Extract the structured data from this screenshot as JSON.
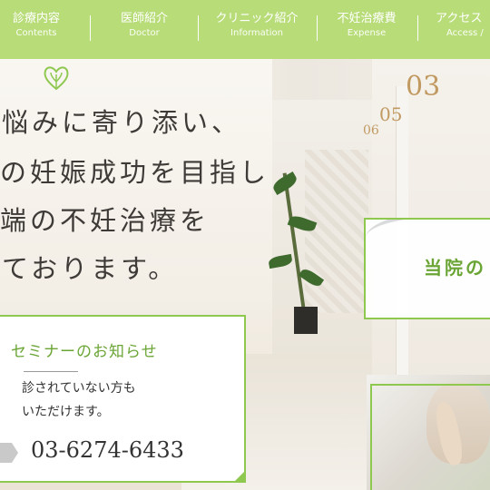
{
  "nav": {
    "items": [
      {
        "jp": "診療内容",
        "en": "Contents"
      },
      {
        "jp": "医師紹介",
        "en": "Doctor"
      },
      {
        "jp": "クリニック紹介",
        "en": "Information"
      },
      {
        "jp": "不妊治療費",
        "en": "Expense"
      },
      {
        "jp": "アクセス",
        "en": "Access /"
      }
    ],
    "background": "#b8dc78"
  },
  "logo": {
    "icon": "leaf-heart-icon",
    "color": "#8fc84f"
  },
  "hero": {
    "lines": [
      "悩みに寄り添い、",
      "の妊娠成功を目指し",
      "端の不妊治療を",
      "ております。"
    ],
    "room_numbers": [
      "03",
      "05",
      "06"
    ]
  },
  "seminar": {
    "title": "セミナーのお知らせ",
    "line1": "診されていない方も",
    "line2": "いただけます。",
    "phone": "03-6274-6433",
    "accent": "#8fc84f"
  },
  "clinic_card": {
    "label": "当院の"
  },
  "colors": {
    "accent_green": "#8fc84f",
    "text_green": "#6aa535",
    "text_dark": "#3d3a37"
  }
}
